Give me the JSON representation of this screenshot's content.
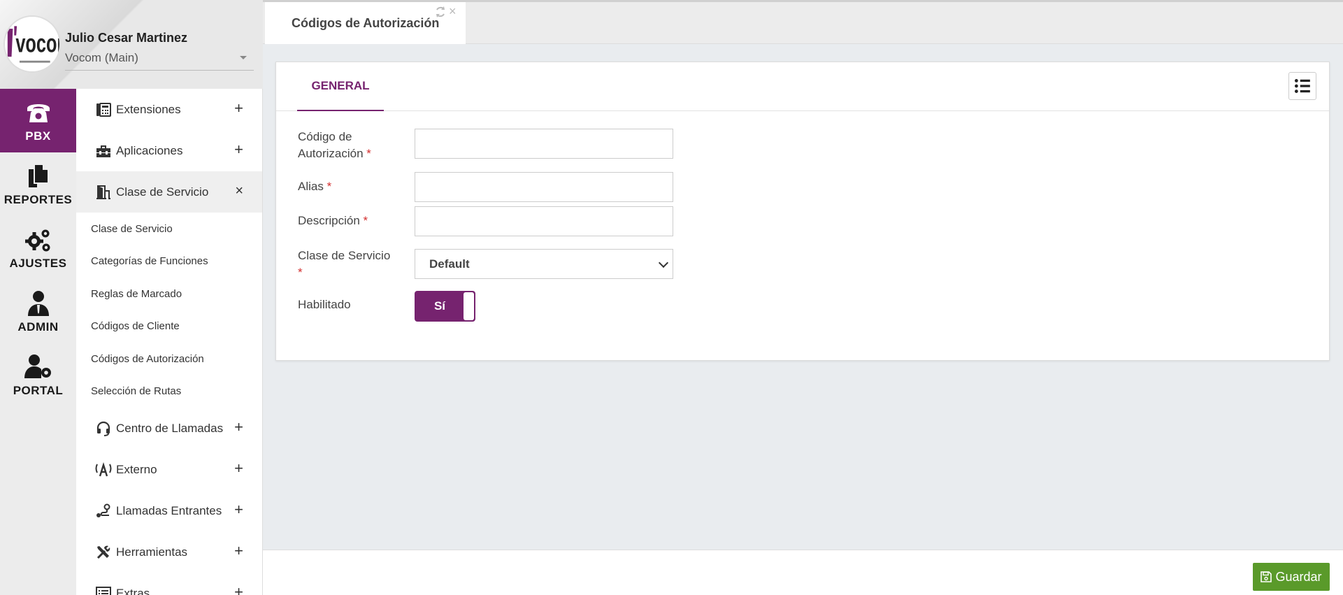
{
  "profile": {
    "name": "Julio Cesar Martinez",
    "company": "Vocom (Main)",
    "logo_text": "vocom"
  },
  "rail": [
    {
      "label": "PBX",
      "icon": "phone-icon",
      "active": true
    },
    {
      "label": "REPORTES",
      "icon": "documents-icon"
    },
    {
      "label": "AJUSTES",
      "icon": "gears-icon"
    },
    {
      "label": "ADMIN",
      "icon": "admin-user-icon"
    },
    {
      "label": "PORTAL",
      "icon": "user-gear-icon"
    }
  ],
  "menu": {
    "items_top": [
      {
        "label": "Extensiones",
        "icon": "phone-extension-icon",
        "toggle": "+"
      },
      {
        "label": "Aplicaciones",
        "icon": "toolbox-icon",
        "toggle": "+"
      },
      {
        "label": "Clase de Servicio",
        "icon": "door-icon",
        "toggle": "×"
      }
    ],
    "sub_items": [
      "Clase de Servicio",
      "Categorías de Funciones",
      "Reglas de Marcado",
      "Códigos de Cliente",
      "Códigos de Autorización",
      "Selección de Rutas"
    ],
    "items_bottom": [
      {
        "label": "Centro de Llamadas",
        "icon": "headset-icon",
        "toggle": "+"
      },
      {
        "label": "Externo",
        "icon": "antenna-icon",
        "toggle": "+"
      },
      {
        "label": "Llamadas Entrantes",
        "icon": "route-icon",
        "toggle": "+"
      },
      {
        "label": "Herramientas",
        "icon": "tools-icon",
        "toggle": "+"
      },
      {
        "label": "Extras",
        "icon": "list-icon",
        "toggle": "+"
      }
    ]
  },
  "tab": {
    "title": "Códigos de Autorización",
    "close": "×"
  },
  "card": {
    "tab_general": "GENERAL",
    "fields": {
      "codigo_label_1": "Código de",
      "codigo_label_2": "Autorización",
      "alias_label": "Alias",
      "descripcion_label": "Descripción",
      "clase_label": "Clase de Servicio",
      "clase_value": "Default",
      "habilitado_label": "Habilitado",
      "habilitado_value": "Sí",
      "required_mark": "*"
    }
  },
  "footer": {
    "save_label": "Guardar"
  },
  "colors": {
    "brand": "#76236f",
    "save": "#5a9a2a",
    "required": "#d32f2f"
  }
}
